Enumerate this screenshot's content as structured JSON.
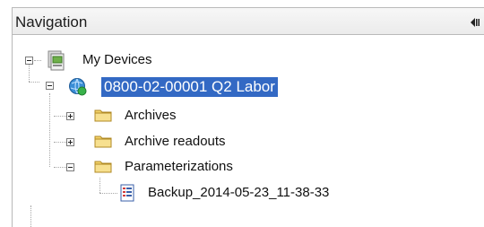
{
  "panel": {
    "title": "Navigation",
    "collapse_icon": "pin-collapse-icon"
  },
  "tree": {
    "root": {
      "label": "My Devices",
      "icon": "devices-icon",
      "expanded": true
    },
    "device": {
      "label": "0800-02-00001 Q2 Labor",
      "icon": "device-globe-icon",
      "expanded": true,
      "selected": true
    },
    "children": [
      {
        "label": "Archives",
        "icon": "folder-icon",
        "expanded": false
      },
      {
        "label": "Archive readouts",
        "icon": "folder-icon",
        "expanded": false
      },
      {
        "label": "Parameterizations",
        "icon": "folder-icon",
        "expanded": true
      }
    ],
    "backup": {
      "label": "Backup_2014-05-23_11-38-33",
      "icon": "document-icon"
    }
  },
  "colors": {
    "selection": "#3369c4",
    "folder": "#f3d36b",
    "header_bg": "#ebebeb"
  }
}
